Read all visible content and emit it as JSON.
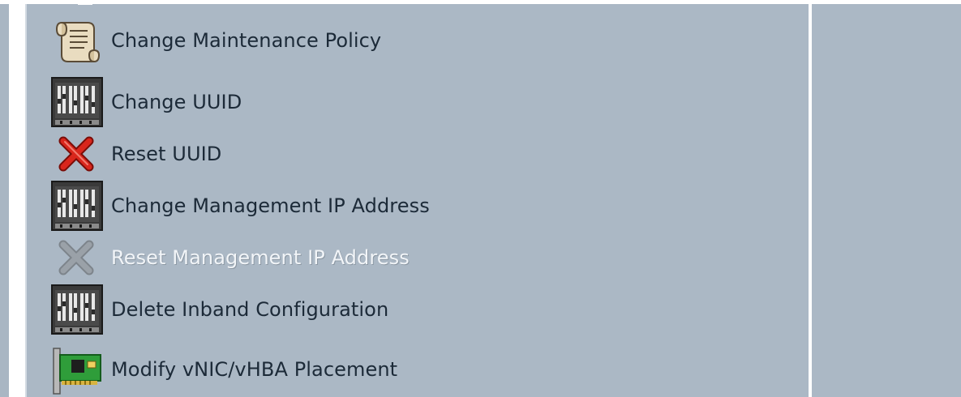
{
  "actions": [
    {
      "label": "Change Maintenance Policy",
      "icon": "scroll-policy-icon",
      "enabled": true
    },
    {
      "label": "Change UUID",
      "icon": "server-rack-icon",
      "enabled": true
    },
    {
      "label": "Reset UUID",
      "icon": "red-x-icon",
      "enabled": true
    },
    {
      "label": "Change Management IP Address",
      "icon": "server-rack-icon",
      "enabled": true
    },
    {
      "label": "Reset Management IP Address",
      "icon": "gray-x-icon",
      "enabled": false
    },
    {
      "label": "Delete Inband Configuration",
      "icon": "server-rack-icon",
      "enabled": true
    },
    {
      "label": "Modify vNIC/vHBA Placement",
      "icon": "network-card-icon",
      "enabled": true
    }
  ],
  "colors": {
    "panel_bg": "#abb8c5",
    "label_text": "#1c2a38",
    "disabled_text": "#f2f5f8",
    "red_x": "#d9261c",
    "gray_x": "#8e959c",
    "nic_green": "#2f9d3a"
  }
}
